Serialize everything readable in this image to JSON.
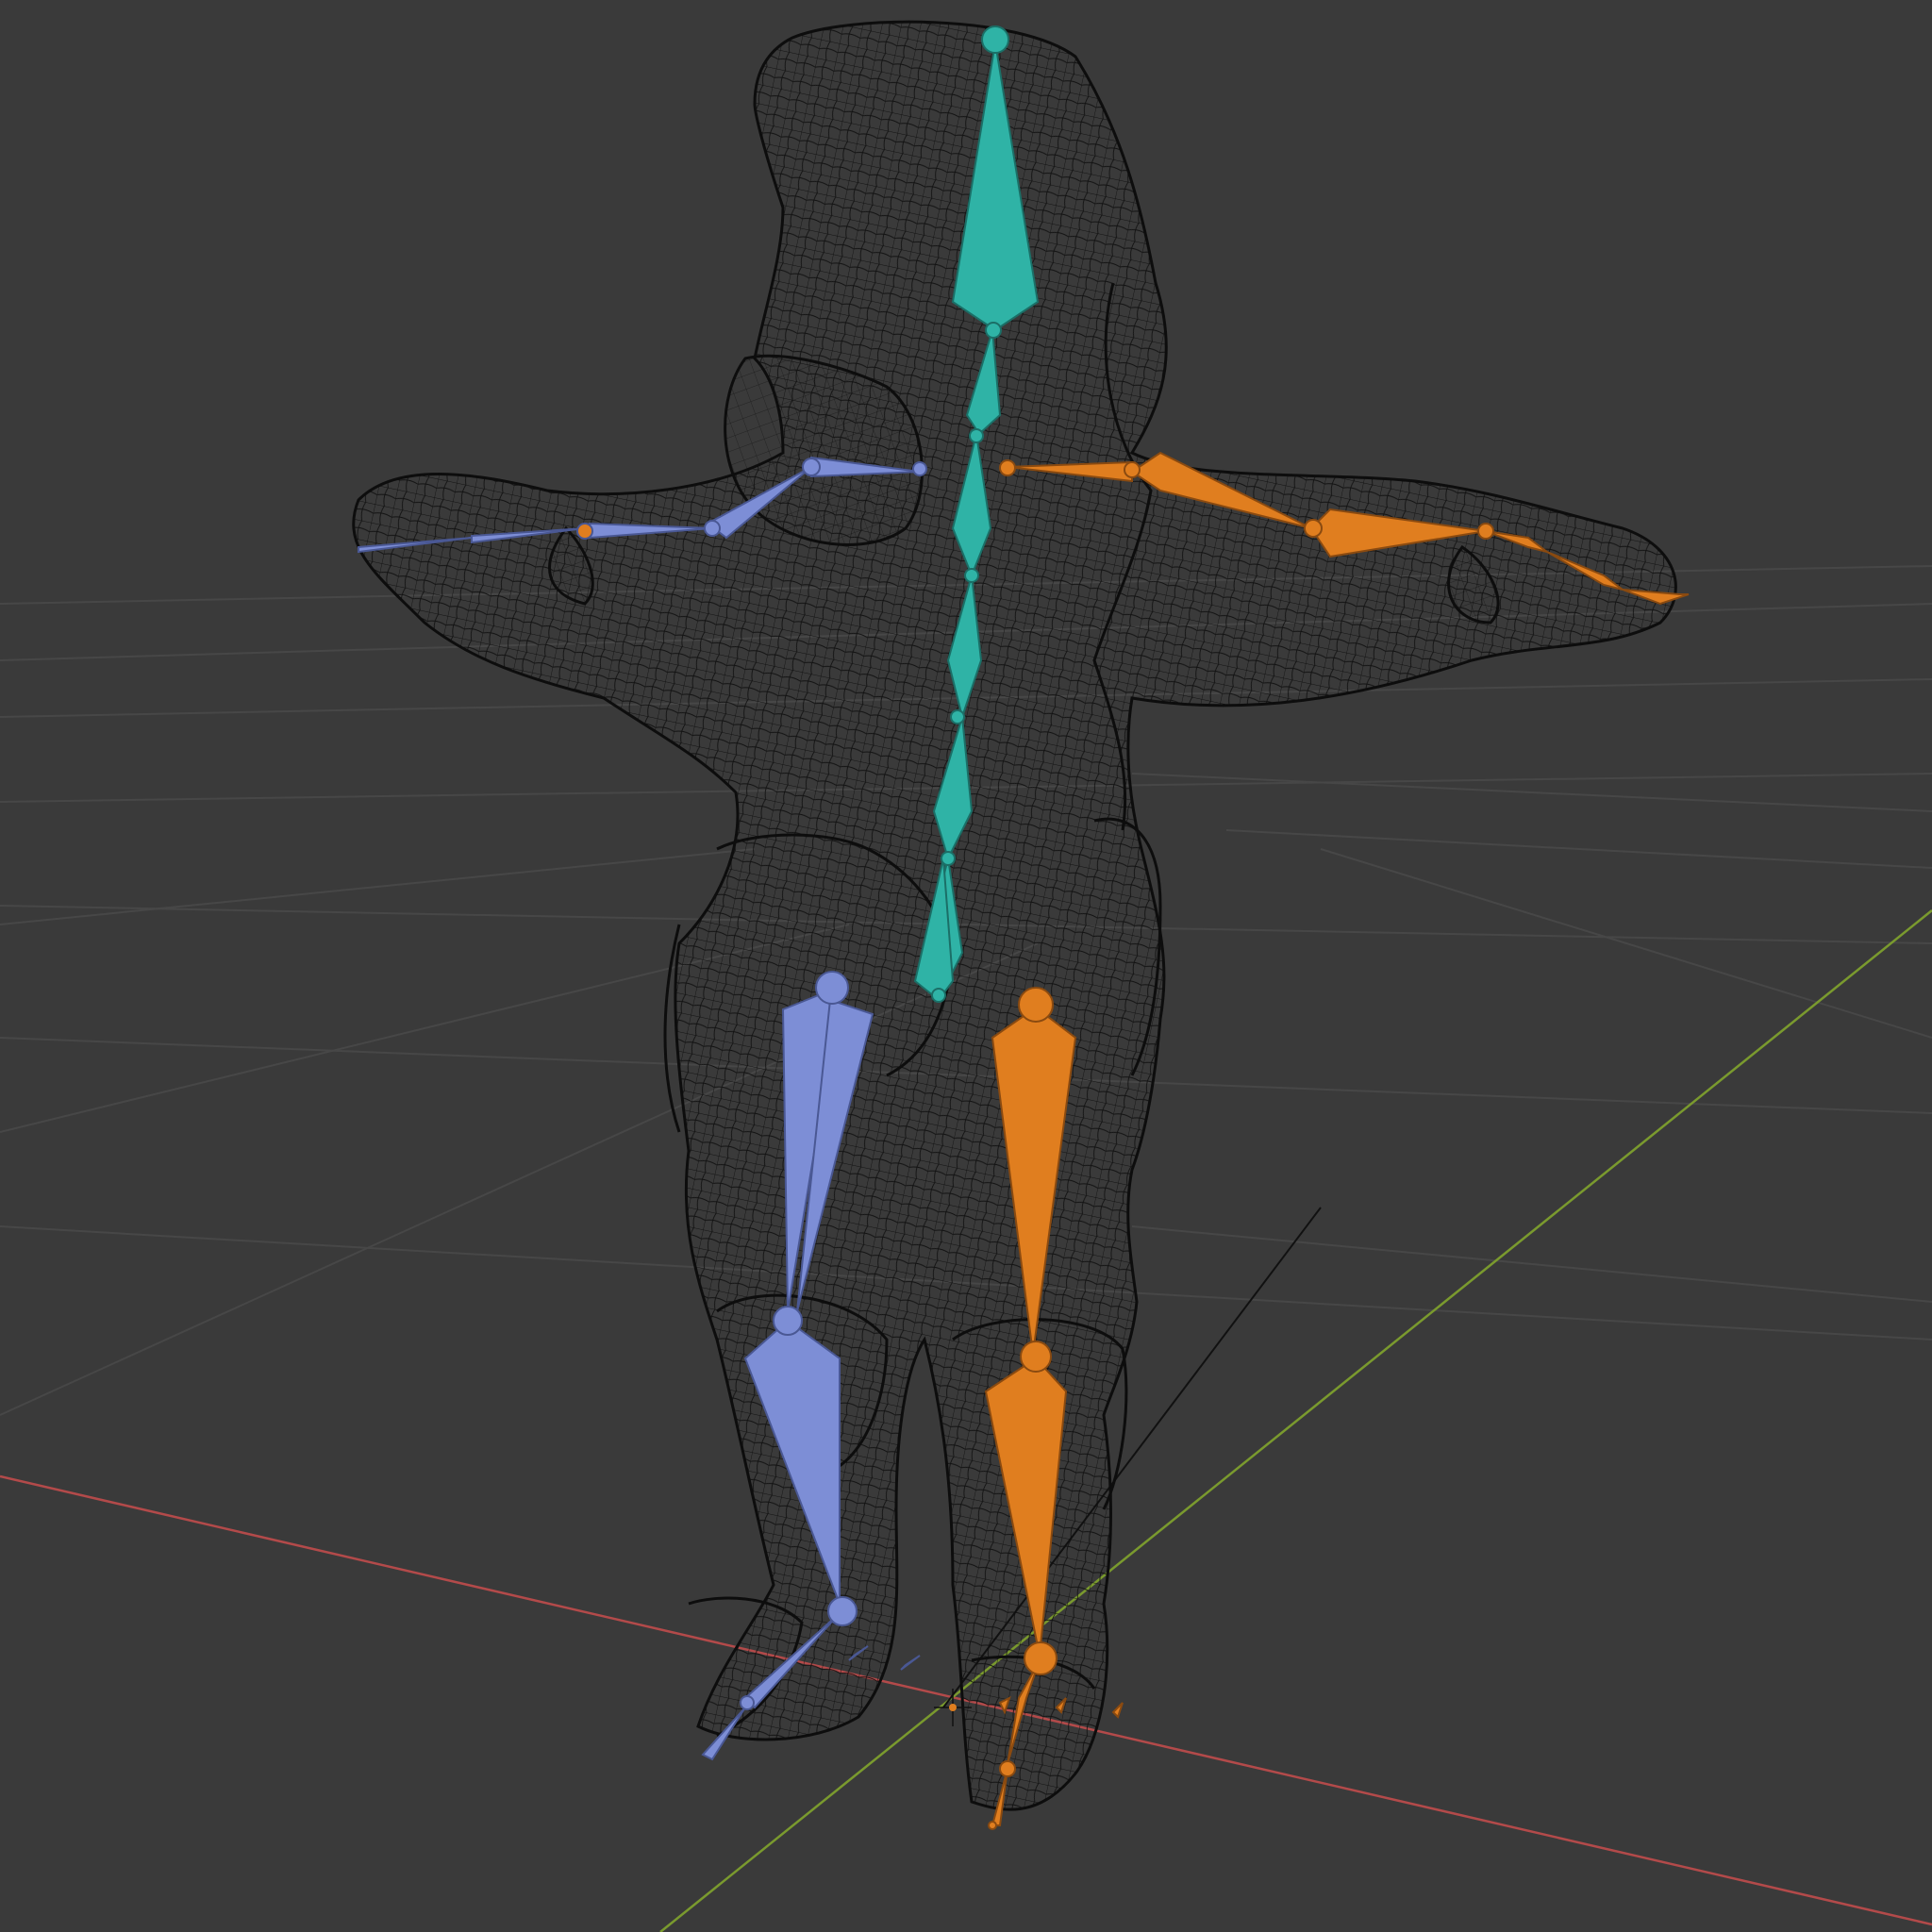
{
  "viewport": {
    "background": "#3a3a3a",
    "grid_color": "#474747",
    "x_axis_color": "#b34a4a",
    "y_axis_color": "#7a9a2e",
    "wire_color": "#0d0d0d"
  },
  "armature": {
    "center_bone_color": "#2fb3a6",
    "left_bone_color": "#7d8ed6",
    "right_bone_color": "#e07e1f"
  }
}
